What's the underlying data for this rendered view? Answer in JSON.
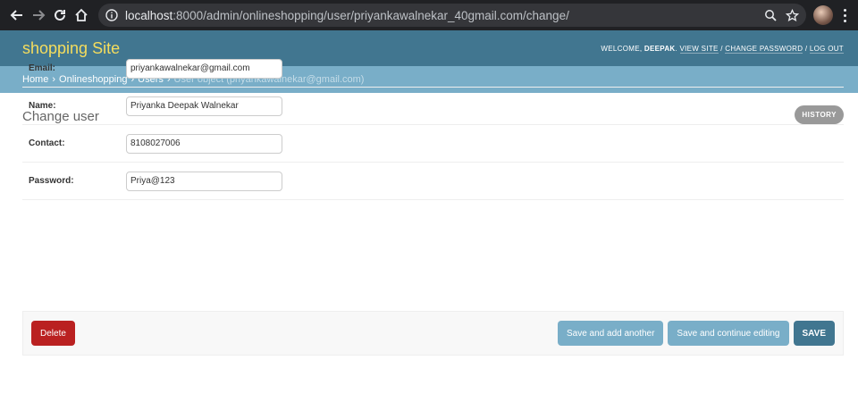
{
  "browser": {
    "url_host": "localhost",
    "url_rest": ":8000/admin/onlineshopping/user/priyankawalnekar_40gmail.com/change/"
  },
  "header": {
    "branding": "shopping Site",
    "welcome": "WELCOME,",
    "username": "DEEPAK",
    "view_site": "VIEW SITE",
    "change_password": "CHANGE PASSWORD",
    "log_out": "LOG OUT",
    "sep": "/"
  },
  "breadcrumbs": {
    "home": "Home",
    "app": "Onlineshopping",
    "model": "Users",
    "current": "User object (priyankawalnekar@gmail.com)",
    "sep": "›"
  },
  "page": {
    "title": "Change user",
    "history": "HISTORY"
  },
  "form": {
    "fields": [
      {
        "label": "Email:",
        "value": "priyankawalnekar@gmail.com"
      },
      {
        "label": "Name:",
        "value": "Priyanka Deepak Walnekar"
      },
      {
        "label": "Contact:",
        "value": "8108027006"
      },
      {
        "label": "Password:",
        "value": "Priya@123"
      }
    ]
  },
  "submit_row": {
    "delete": "Delete",
    "save_add": "Save and add another",
    "save_continue": "Save and continue editing",
    "save": "SAVE"
  },
  "colors": {
    "header_bg": "#417690",
    "breadcrumb_bg": "#79aec8",
    "branding": "#f5dd5d",
    "delete_bg": "#ba2121"
  }
}
